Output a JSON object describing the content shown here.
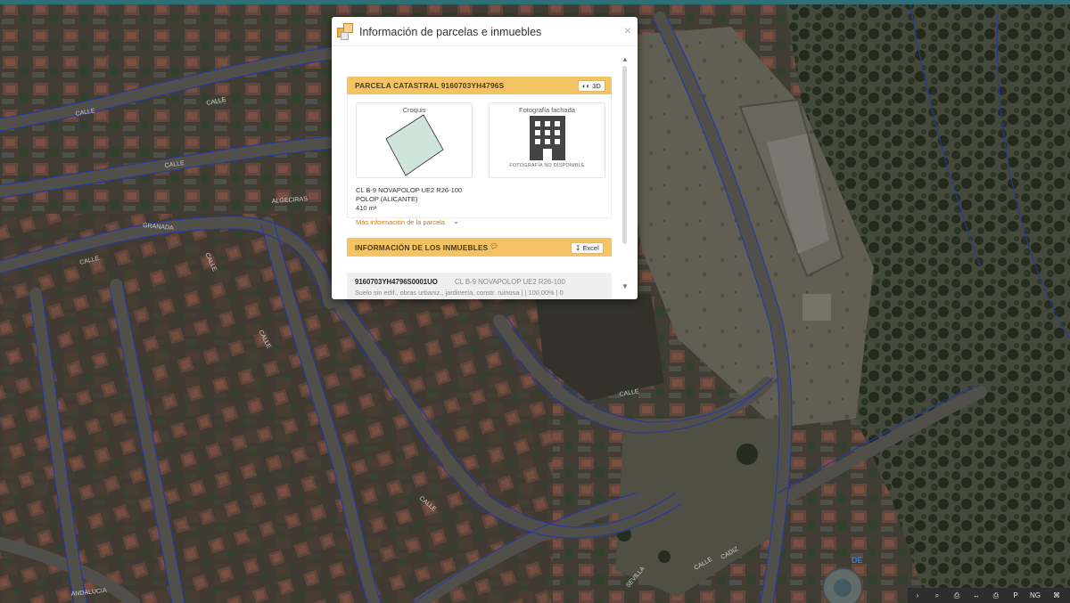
{
  "dialog": {
    "title": "Información de parcelas e inmuebles",
    "close": "×"
  },
  "parcel": {
    "header": "PARCELA CATASTRAL 9160703YH4796S",
    "btn_3d": "3D",
    "croquis_title": "Croquis",
    "photo_title": "Fotografía fachada",
    "photo_unavailable": "FOTOGRAFÍA NO DISPONIBLE",
    "address_line1": "CL B-9 NOVAPOLOP UE2 R26-100",
    "address_line2": "POLOP (ALICANTE)",
    "area": "410 m²",
    "more_info": "Más información de la parcela"
  },
  "inmuebles": {
    "header": "INFORMACIÓN DE LOS INMUEBLES",
    "excel": "Excel",
    "rows": [
      {
        "ref": "9160703YH4796S0001UO",
        "address": "CL B-9 NOVAPOLOP UE2 R26-100",
        "desc": "Suelo sin edif., obras urbaniz., jardinería, constr. ruinosa | | 100,00% | 0"
      }
    ]
  },
  "map": {
    "street_labels": [
      "CALLE",
      "CALLE",
      "CALLE",
      "CALLE",
      "CALLE",
      "CALLE",
      "GRANADA",
      "ALGECIRAS",
      "CALLE",
      "CALLE",
      "CALLE",
      "CADIZ",
      "SEVILLA",
      "DE",
      "ANDALUCIA"
    ]
  },
  "toolbar": {
    "items": [
      "›",
      "⌕",
      "⎙",
      "↔",
      "⎙",
      "P",
      "NG",
      "⌘"
    ]
  },
  "colors": {
    "accent": "#f4c364",
    "link": "#c07a1a",
    "parcel_fill": "#cfe5dc"
  }
}
